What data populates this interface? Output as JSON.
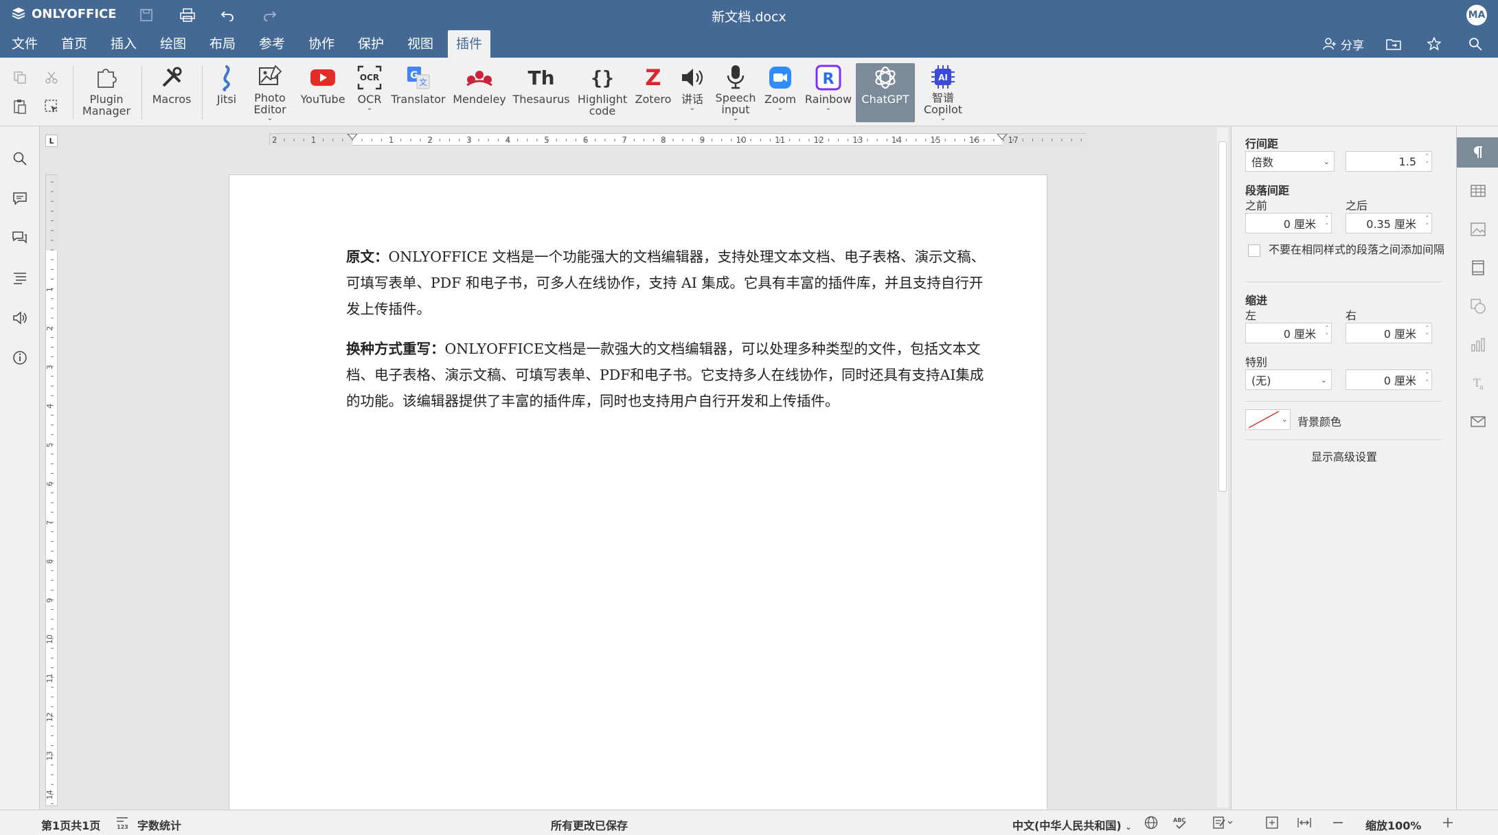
{
  "app": {
    "brand": "ONLYOFFICE",
    "doc_title": "新文档.docx",
    "avatar": "MA"
  },
  "colors": {
    "header": "#446995",
    "accent": "#7c8a99"
  },
  "menu": {
    "tabs": [
      "文件",
      "首页",
      "插入",
      "绘图",
      "布局",
      "参考",
      "协作",
      "保护",
      "视图",
      "插件"
    ],
    "active_tab": "插件",
    "share_label": "分享"
  },
  "toolbar": {
    "plugins": [
      {
        "label": "Plugin\nManager",
        "icon": "puzzle-icon"
      },
      {
        "label": "Macros",
        "icon": "tools-icon"
      },
      {
        "label": "Jitsi",
        "icon": "jitsi-icon"
      },
      {
        "label": "Photo\nEditor",
        "icon": "photo-editor-icon",
        "dropdown": true
      },
      {
        "label": "YouTube",
        "icon": "youtube-icon"
      },
      {
        "label": "OCR",
        "icon": "ocr-icon",
        "dropdown": true
      },
      {
        "label": "Translator",
        "icon": "translator-icon"
      },
      {
        "label": "Mendeley",
        "icon": "mendeley-icon"
      },
      {
        "label": "Thesaurus",
        "icon": "thesaurus-icon"
      },
      {
        "label": "Highlight\ncode",
        "icon": "braces-icon"
      },
      {
        "label": "Zotero",
        "icon": "zotero-icon"
      },
      {
        "label": "讲话",
        "icon": "speaker-icon",
        "dropdown": true
      },
      {
        "label": "Speech\ninput",
        "icon": "microphone-icon",
        "dropdown": true
      },
      {
        "label": "Zoom",
        "icon": "zoom-icon",
        "dropdown": true
      },
      {
        "label": "Rainbow",
        "icon": "rainbow-icon",
        "dropdown": true
      },
      {
        "label": "ChatGPT",
        "icon": "chatgpt-icon",
        "active": true
      },
      {
        "label": "智谱\nCopilot",
        "icon": "ai-chip-icon",
        "dropdown": true
      }
    ]
  },
  "document": {
    "paragraphs": [
      {
        "lead": "原文：",
        "text": "ONLYOFFICE 文档是一个功能强大的文档编辑器，支持处理文本文档、电子表格、演示文稿、可填写表单、PDF 和电子书，可多人在线协作，支持 AI 集成。它具有丰富的插件库，并且支持自行开发上传插件。"
      },
      {
        "lead": "换种方式重写：",
        "text": "ONLYOFFICE文档是一款强大的文档编辑器，可以处理多种类型的文件，包括文本文档、电子表格、演示文稿、可填写表单、PDF和电子书。它支持多人在线协作，同时还具有支持AI集成的功能。该编辑器提供了丰富的插件库，同时也支持用户自行开发和上传插件。"
      }
    ]
  },
  "ruler": {
    "h_labels": [
      "2",
      "1",
      "1",
      "2",
      "3",
      "4",
      "5",
      "6",
      "7",
      "8",
      "9",
      "10",
      "11",
      "12",
      "13",
      "14",
      "15",
      "16",
      "17"
    ],
    "v_labels": [
      "1",
      "2",
      "3",
      "4",
      "5",
      "6",
      "7",
      "8",
      "9",
      "10",
      "11",
      "12",
      "13",
      "14"
    ],
    "corner": "L"
  },
  "paragraph_panel": {
    "line_spacing_title": "行间距",
    "line_spacing_mode": "倍数",
    "line_spacing_value": "1.5",
    "para_spacing_title": "段落间距",
    "before_label": "之前",
    "after_label": "之后",
    "before_value": "0 厘米",
    "after_value": "0.35 厘米",
    "no_space_same_style": "不要在相同样式的段落之间添加间隔",
    "indent_title": "缩进",
    "left_label": "左",
    "right_label": "右",
    "left_value": "0 厘米",
    "right_value": "0 厘米",
    "special_label": "特别",
    "special_value": "(无)",
    "special_amount": "0 厘米",
    "bg_color_label": "背景颜色",
    "advanced_link": "显示高级设置"
  },
  "status": {
    "page_info": "第1页共1页",
    "word_count": "字数统计",
    "save_state": "所有更改已保存",
    "language": "中文(中华人民共和国)",
    "zoom": "缩放100%"
  }
}
